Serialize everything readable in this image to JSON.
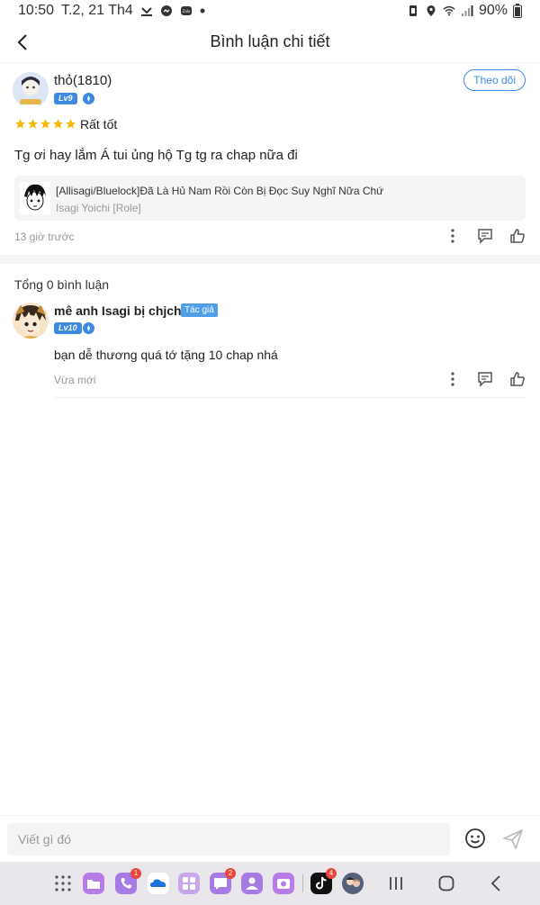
{
  "status": {
    "time": "10:50",
    "date": "T.2, 21 Th4",
    "battery": "90%"
  },
  "header": {
    "title": "Bình luận chi tiết"
  },
  "review": {
    "username": "thỏ(1810)",
    "level": "Lv9",
    "follow_label": "Theo dõi",
    "stars": 5,
    "rating_label": "Rất tốt",
    "text": "Tg ơi hay lắm Á tui ủng hộ Tg tg ra chap nữa đi",
    "book": {
      "title": "[Allisagi/Bluelock]Đã Là Hủ Nam Rồi Còn Bị Đọc Suy Nghĩ Nữa Chứ",
      "subtitle": "Isagi Yoichi [Role]"
    },
    "time": "13 giờ trước"
  },
  "comments": {
    "total_label": "Tổng 0 bình luận",
    "items": [
      {
        "username": "mê anh Isagi bị chjch",
        "author_tag": "Tác giả",
        "level": "Lv10",
        "text": "bạn dễ thương quá tớ tặng 10 chap nhá",
        "time": "Vừa mới"
      }
    ]
  },
  "composer": {
    "placeholder": "Viết gì đó"
  },
  "dock": {
    "badges": {
      "phone": "1",
      "messages": "2",
      "tiktok": "4"
    }
  },
  "colors": {
    "accent": "#3d8ae0",
    "star": "#f5b800",
    "badge_red": "#e8453c"
  }
}
